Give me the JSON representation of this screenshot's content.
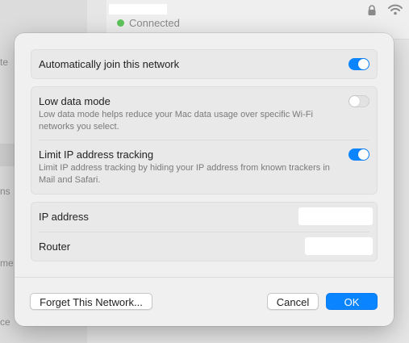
{
  "background": {
    "sidebar_fragments": [
      "te",
      "ns",
      "me",
      "ce"
    ],
    "network_status": "Connected"
  },
  "dialog": {
    "auto_join": {
      "label": "Automatically join this network",
      "enabled": true
    },
    "low_data_mode": {
      "label": "Low data mode",
      "description": "Low data mode helps reduce your Mac data usage over specific Wi-Fi networks you select.",
      "enabled": false
    },
    "limit_ip_tracking": {
      "label": "Limit IP address tracking",
      "description": "Limit IP address tracking by hiding your IP address from known trackers in Mail and Safari.",
      "enabled": true
    },
    "ip_address": {
      "label": "IP address",
      "value": ""
    },
    "router": {
      "label": "Router",
      "value": ""
    },
    "buttons": {
      "forget": "Forget This Network...",
      "cancel": "Cancel",
      "ok": "OK"
    }
  },
  "colors": {
    "accent": "#0a84ff",
    "connected_dot": "#5fc55b"
  }
}
